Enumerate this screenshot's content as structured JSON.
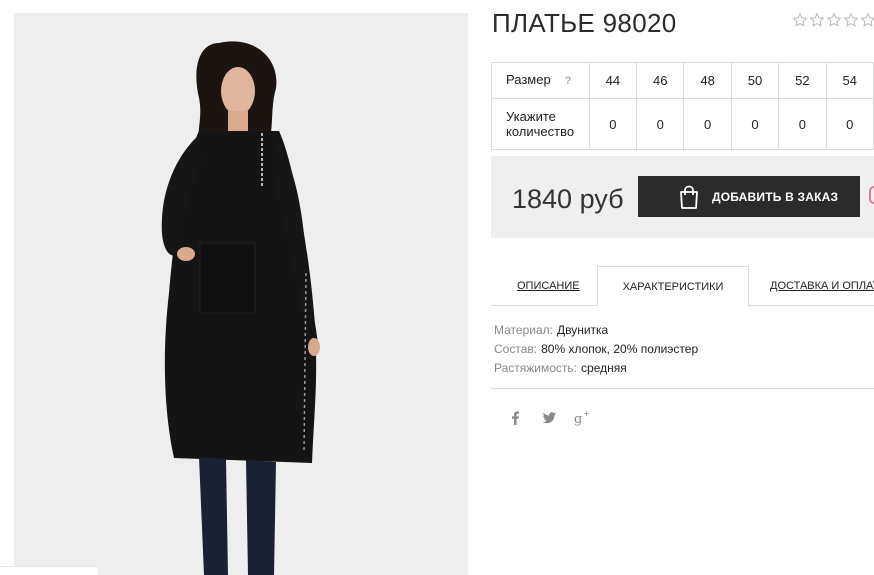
{
  "product": {
    "title": "ПЛАТЬЕ 98020",
    "rating": 0,
    "rating_max": 5
  },
  "size_table": {
    "size_label": "Размер",
    "help_icon": "?",
    "sizes": [
      "44",
      "46",
      "48",
      "50",
      "52",
      "54"
    ],
    "qty_label": "Укажите количество",
    "quantities": [
      "0",
      "0",
      "0",
      "0",
      "0",
      "0"
    ]
  },
  "purchase": {
    "price": "1840 руб",
    "order_button": "ДОБАВИТЬ В ЗАКАЗ",
    "button_icon": "shopping-bag-icon"
  },
  "tabs": [
    {
      "label": "ОПИСАНИЕ",
      "active": false
    },
    {
      "label": "ХАРАКТЕРИСТИКИ",
      "active": true
    },
    {
      "label": "ДОСТАВКА И ОПЛАТ",
      "active": false
    }
  ],
  "specs": [
    {
      "key": "Материал:",
      "value": "Двунитка"
    },
    {
      "key": "Состав:",
      "value": "80% хлопок, 20% полиэстер"
    },
    {
      "key": "Растяжимость:",
      "value": "средняя"
    }
  ],
  "social": [
    {
      "label": "f",
      "icon": "facebook-icon"
    },
    {
      "label": "twitter",
      "icon": "twitter-icon"
    },
    {
      "label": "g+",
      "icon": "google-plus-icon"
    }
  ],
  "colors": {
    "button_bg": "#2b2b2b",
    "price_box_bg": "#efefef",
    "photo_bg": "#eeeeee",
    "accent_pink": "#e2789a"
  }
}
